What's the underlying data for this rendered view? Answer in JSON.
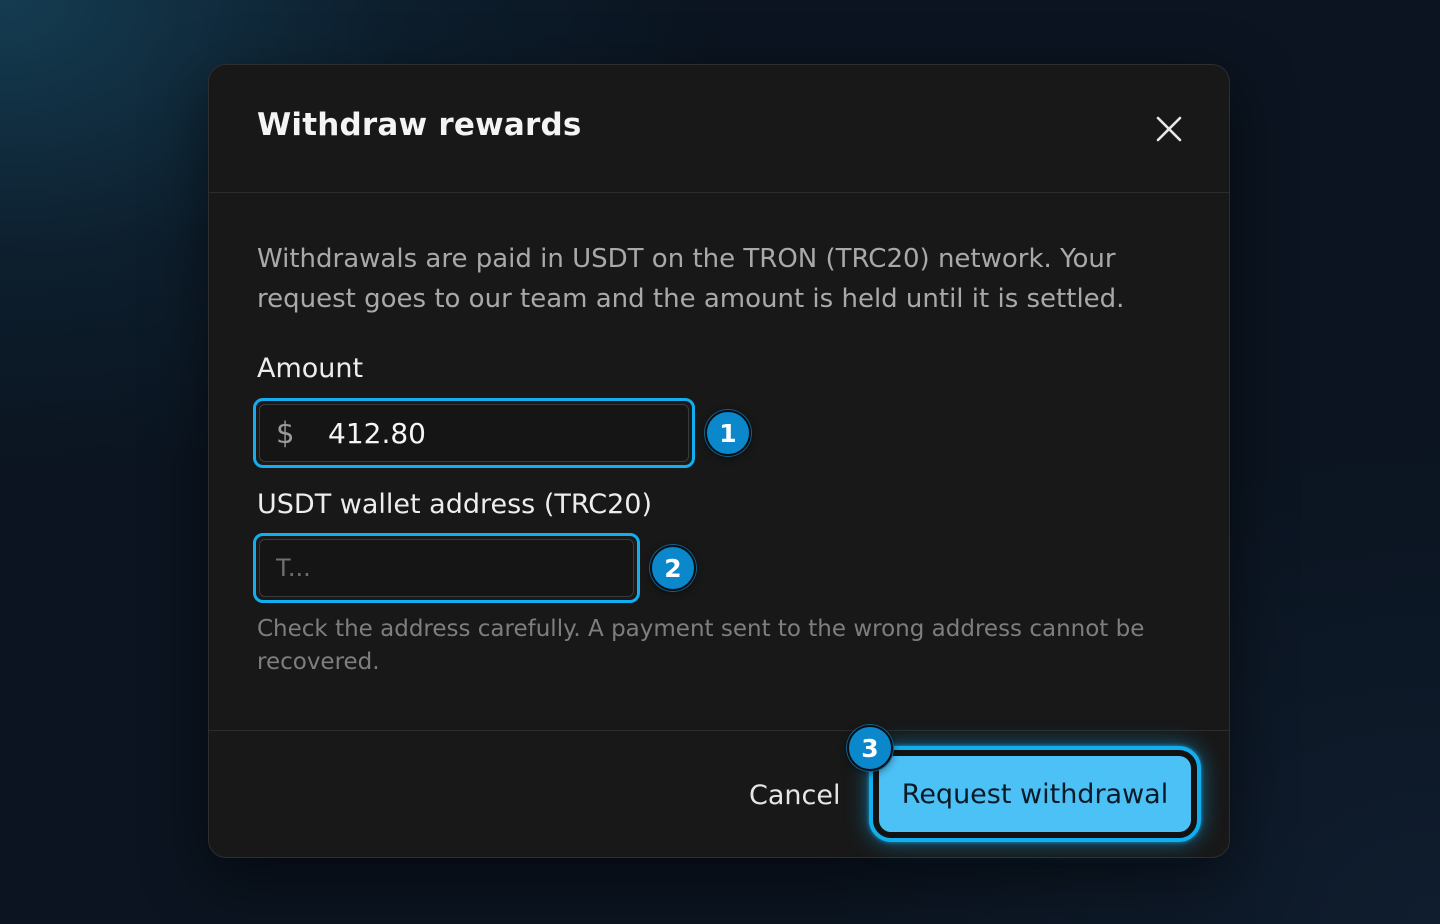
{
  "modal": {
    "title": "Withdraw rewards",
    "close_icon": "close-icon",
    "description": "Withdrawals are paid in USDT on the TRON (TRC20) network. Your request goes to our team and the amount is held until it is settled."
  },
  "form": {
    "amount": {
      "label": "Amount",
      "currency_symbol": "$",
      "value": "412.80"
    },
    "wallet": {
      "label": "USDT wallet address (TRC20)",
      "value": "",
      "placeholder": "T..."
    },
    "helper_text": "Check the address carefully. A payment sent to the wrong address cannot be recovered."
  },
  "footer": {
    "cancel_label": "Cancel",
    "submit_label": "Request withdrawal"
  },
  "markers": [
    "1",
    "2",
    "3"
  ],
  "colors": {
    "accent": "#12aef0",
    "primary_button": "#4cc1f6",
    "marker": "#0b88cc",
    "modal_background": "#181818"
  }
}
